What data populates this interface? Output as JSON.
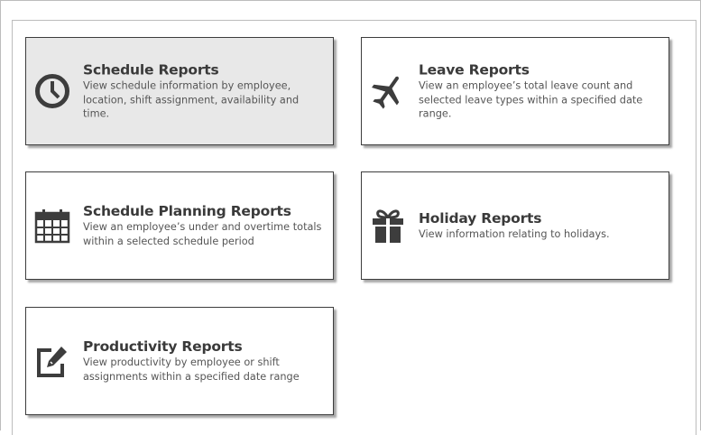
{
  "reports": [
    {
      "title": "Schedule Reports",
      "description": "View schedule information by employee, location, shift assignment, availability and time.",
      "icon": "clock-icon",
      "selected": true
    },
    {
      "title": "Leave Reports",
      "description": "View an employee’s total leave count and selected leave types within a specified date range.",
      "icon": "airplane-icon",
      "selected": false
    },
    {
      "title": "Schedule Planning Reports",
      "description": "View an employee’s under and overtime totals within a selected schedule period",
      "icon": "calendar-icon",
      "selected": false
    },
    {
      "title": "Holiday Reports",
      "description": "View information relating to holidays.",
      "icon": "gift-icon",
      "selected": false
    },
    {
      "title": "Productivity Reports",
      "description": "View productivity by employee or shift assignments within a specified date range",
      "icon": "edit-icon",
      "selected": false
    }
  ],
  "colors": {
    "icon": "#3d3d3d",
    "selected_card_bg": "#e8e8e8",
    "card_border": "#3d3d3d"
  }
}
